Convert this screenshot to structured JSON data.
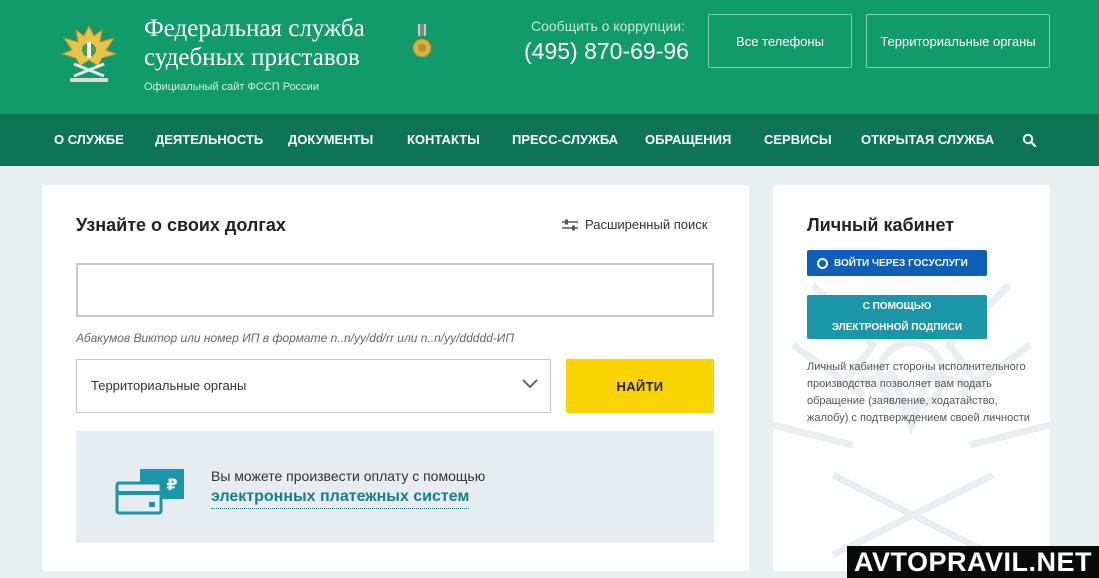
{
  "header": {
    "title_line1": "Федеральная служба",
    "title_line2": "судебных приставов",
    "subtitle": "Официальный сайт ФССП России",
    "emblem_icon": "eagle-emblem-icon",
    "medal_icon": "medal-icon",
    "corruption_label": "Сообщить о коррупции:",
    "corruption_phone": "(495) 870-69-96",
    "phones_button": "Все телефоны",
    "regions_button": "Территориальные органы",
    "colors": {
      "header_bg": "#119b6b",
      "nav_bg": "#0d7554"
    }
  },
  "nav": {
    "items": [
      {
        "label": "О СЛУЖБЕ"
      },
      {
        "label": "ДЕЯТЕЛЬНОСТЬ"
      },
      {
        "label": "ДОКУМЕНТЫ"
      },
      {
        "label": "КОНТАКТЫ"
      },
      {
        "label": "ПРЕСС-СЛУЖБА"
      },
      {
        "label": "ОБРАЩЕНИЯ"
      },
      {
        "label": "СЕРВИСЫ"
      },
      {
        "label": "ОТКРЫТАЯ СЛУЖБА"
      }
    ],
    "search_icon": "search-icon"
  },
  "debt_search": {
    "title": "Узнайте о своих долгах",
    "advanced_label": "Расширенный поиск",
    "input_value": "",
    "hint": "Абакумов Виктор или номер ИП в формате n..n/yy/dd/rr или n..n/yy/ddddd-ИП",
    "region_select": "Территориальные органы",
    "find_button": "НАЙТИ",
    "payment_text": "Вы можете произвести оплату с помощью",
    "payment_link": "электронных платежных систем",
    "colors": {
      "find_button": "#fad400",
      "link": "#16808f"
    }
  },
  "cabinet": {
    "title": "Личный кабинет",
    "gosuslugi_button": "ВОЙТИ ЧЕРЕЗ ГОСУСЛУГИ",
    "signature_line1": "С ПОМОЩЬЮ",
    "signature_line2": "ЭЛЕКТРОННОЙ ПОДПИСИ",
    "description": "Личный кабинет стороны исполнительного производства позволяет вам подать обращение (заявление, ходатайство, жалобу) с подтверждением своей личности",
    "colors": {
      "gosuslugi": "#0d5fb8",
      "signature": "#1b95a8"
    }
  },
  "watermark": {
    "text": "AVTOPRAVIL.NET"
  }
}
